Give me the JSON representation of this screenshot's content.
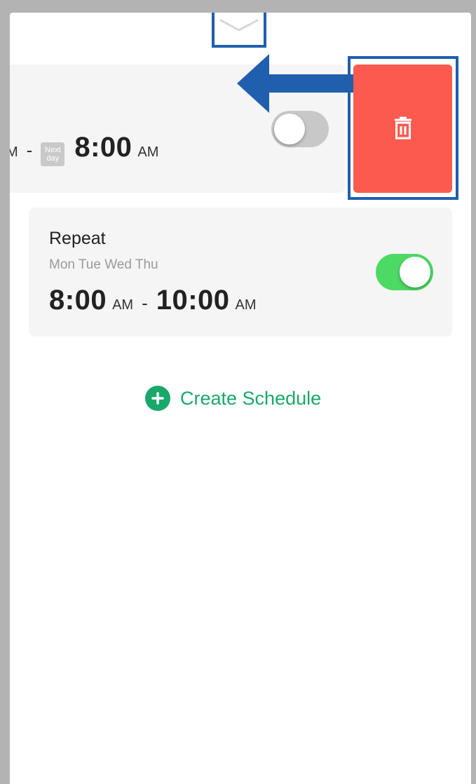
{
  "schedule_1": {
    "cut_prefix": "M",
    "dash": "-",
    "next_day_line1": "Next",
    "next_day_line2": "day",
    "end_time": "8:00",
    "end_ampm": "AM",
    "enabled": false
  },
  "schedule_2": {
    "title": "Repeat",
    "days": "Mon Tue Wed Thu",
    "start_time": "8:00",
    "start_ampm": "AM",
    "dash": "-",
    "end_time": "10:00",
    "end_ampm": "AM",
    "enabled": true
  },
  "delete": {
    "icon": "trash-icon"
  },
  "create_schedule": {
    "label": "Create Schedule",
    "icon": "plus-circle-icon"
  },
  "colors": {
    "accent_green": "#1aa86a",
    "toggle_on": "#4cd964",
    "delete_red": "#fd5a4f",
    "highlight_blue": "#1f5fae"
  }
}
